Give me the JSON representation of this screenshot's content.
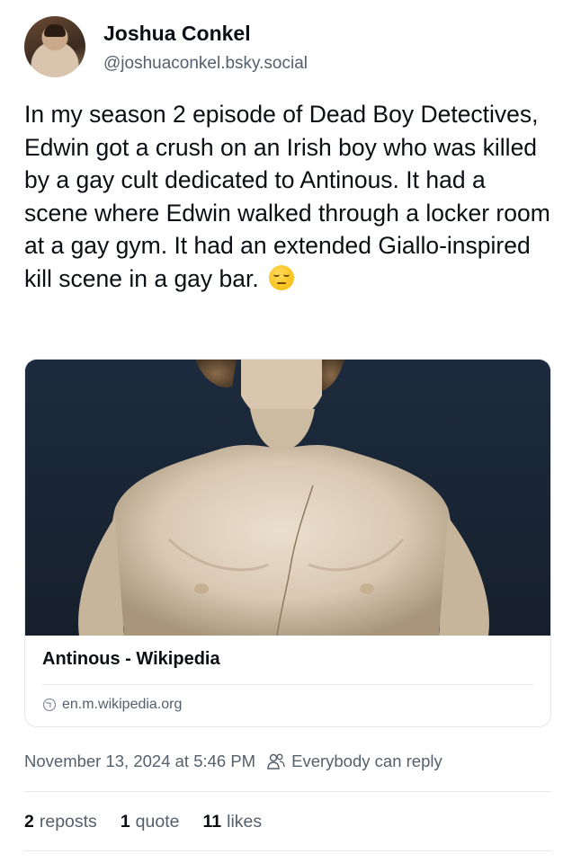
{
  "author": {
    "display_name": "Joshua Conkel",
    "handle": "@joshuaconkel.bsky.social",
    "avatar_icon": "profile-photo"
  },
  "post": {
    "text": "In my season 2 episode of Dead Boy Detectives, Edwin got a crush on an Irish boy who was killed by a gay cult dedicated to Antinous. It had a scene where Edwin walked through a locker room at a gay gym. It had an extended Giallo-inspired kill scene in a gay bar.",
    "emoji_icon": "pensive-face-emoji"
  },
  "embed": {
    "image_icon": "marble-bust-photo",
    "title": "Antinous - Wikipedia",
    "domain": "en.m.wikipedia.org",
    "domain_icon": "globe-icon"
  },
  "meta": {
    "timestamp": "November 13, 2024 at 5:46 PM",
    "reply_setting": "Everybody can reply",
    "reply_icon": "people-icon"
  },
  "stats": {
    "reposts_count": "2",
    "reposts_label": "reposts",
    "quotes_count": "1",
    "quotes_label": "quote",
    "likes_count": "11",
    "likes_label": "likes"
  },
  "colors": {
    "text": "#0b0f14",
    "secondary": "#55606d",
    "border": "#e3e7eb"
  }
}
